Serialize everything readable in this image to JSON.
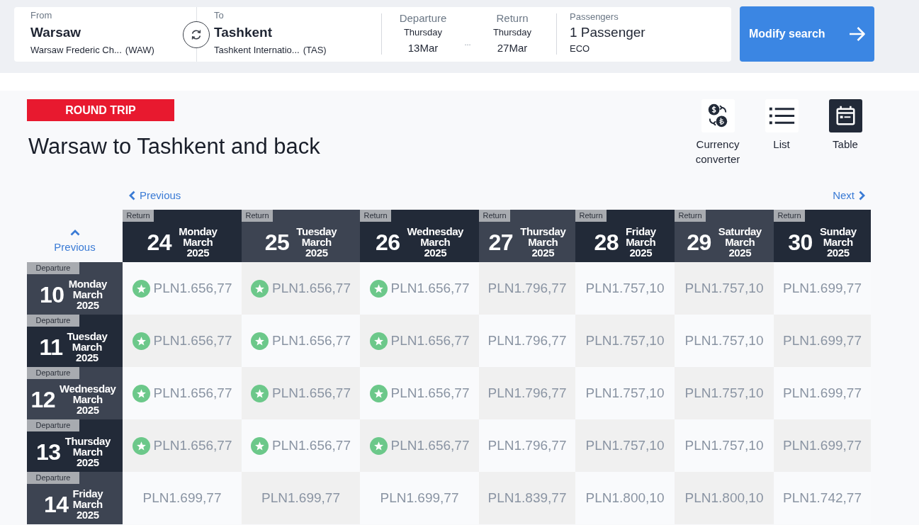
{
  "search_summary": {
    "from": {
      "label": "From",
      "city": "Warsaw",
      "airport": "Warsaw Frederic Ch...",
      "code": "(WAW)"
    },
    "to": {
      "label": "To",
      "city": "Tashkent",
      "airport": "Tashkent Internatio...",
      "code": "(TAS)"
    },
    "departure": {
      "label": "Departure",
      "weekday": "Thursday",
      "date": "13Mar"
    },
    "date_separator": "...",
    "return": {
      "label": "Return",
      "weekday": "Thursday",
      "date": "27Mar"
    },
    "passengers": {
      "label": "Passengers",
      "count": "1 Passenger",
      "cabin": "ECO"
    },
    "modify_button": "Modify search"
  },
  "trip_badge": "ROUND TRIP",
  "title": "Warsaw to Tashkent and back",
  "views": [
    {
      "kind": "currency",
      "label": "Currency converter",
      "selected": false
    },
    {
      "kind": "list",
      "label": "List",
      "selected": false
    },
    {
      "kind": "table",
      "label": "Table",
      "selected": true
    }
  ],
  "fare_table": {
    "previous_return": "Previous",
    "next_return": "Next",
    "previous_departure": "Previous",
    "columns": [
      {
        "tag": "Return",
        "day": "24",
        "weekday": "Monday",
        "month": "March",
        "year": "2025"
      },
      {
        "tag": "Return",
        "day": "25",
        "weekday": "Tuesday",
        "month": "March",
        "year": "2025"
      },
      {
        "tag": "Return",
        "day": "26",
        "weekday": "Wednesday",
        "month": "March",
        "year": "2025"
      },
      {
        "tag": "Return",
        "day": "27",
        "weekday": "Thursday",
        "month": "March",
        "year": "2025"
      },
      {
        "tag": "Return",
        "day": "28",
        "weekday": "Friday",
        "month": "March",
        "year": "2025"
      },
      {
        "tag": "Return",
        "day": "29",
        "weekday": "Saturday",
        "month": "March",
        "year": "2025"
      },
      {
        "tag": "Return",
        "day": "30",
        "weekday": "Sunday",
        "month": "March",
        "year": "2025"
      }
    ],
    "rows": [
      {
        "tag": "Departure",
        "day": "10",
        "weekday": "Monday",
        "month": "March",
        "year": "2025",
        "cells": [
          {
            "price": "PLN1.656,77",
            "starred": true
          },
          {
            "price": "PLN1.656,77",
            "starred": true
          },
          {
            "price": "PLN1.656,77",
            "starred": true
          },
          {
            "price": "PLN1.796,77",
            "starred": false
          },
          {
            "price": "PLN1.757,10",
            "starred": false
          },
          {
            "price": "PLN1.757,10",
            "starred": false
          },
          {
            "price": "PLN1.699,77",
            "starred": false
          }
        ]
      },
      {
        "tag": "Departure",
        "day": "11",
        "weekday": "Tuesday",
        "month": "March",
        "year": "2025",
        "cells": [
          {
            "price": "PLN1.656,77",
            "starred": true
          },
          {
            "price": "PLN1.656,77",
            "starred": true
          },
          {
            "price": "PLN1.656,77",
            "starred": true
          },
          {
            "price": "PLN1.796,77",
            "starred": false
          },
          {
            "price": "PLN1.757,10",
            "starred": false
          },
          {
            "price": "PLN1.757,10",
            "starred": false
          },
          {
            "price": "PLN1.699,77",
            "starred": false
          }
        ]
      },
      {
        "tag": "Departure",
        "day": "12",
        "weekday": "Wednesday",
        "month": "March",
        "year": "2025",
        "cells": [
          {
            "price": "PLN1.656,77",
            "starred": true
          },
          {
            "price": "PLN1.656,77",
            "starred": true
          },
          {
            "price": "PLN1.656,77",
            "starred": true
          },
          {
            "price": "PLN1.796,77",
            "starred": false
          },
          {
            "price": "PLN1.757,10",
            "starred": false
          },
          {
            "price": "PLN1.757,10",
            "starred": false
          },
          {
            "price": "PLN1.699,77",
            "starred": false
          }
        ]
      },
      {
        "tag": "Departure",
        "day": "13",
        "weekday": "Thursday",
        "month": "March",
        "year": "2025",
        "cells": [
          {
            "price": "PLN1.656,77",
            "starred": true
          },
          {
            "price": "PLN1.656,77",
            "starred": true
          },
          {
            "price": "PLN1.656,77",
            "starred": true
          },
          {
            "price": "PLN1.796,77",
            "starred": false
          },
          {
            "price": "PLN1.757,10",
            "starred": false
          },
          {
            "price": "PLN1.757,10",
            "starred": false
          },
          {
            "price": "PLN1.699,77",
            "starred": false
          }
        ]
      },
      {
        "tag": "Departure",
        "day": "14",
        "weekday": "Friday",
        "month": "March",
        "year": "2025",
        "cells": [
          {
            "price": "PLN1.699,77",
            "starred": false
          },
          {
            "price": "PLN1.699,77",
            "starred": false
          },
          {
            "price": "PLN1.699,77",
            "starred": false
          },
          {
            "price": "PLN1.839,77",
            "starred": false
          },
          {
            "price": "PLN1.800,10",
            "starred": false
          },
          {
            "price": "PLN1.800,10",
            "starred": false
          },
          {
            "price": "PLN1.742,77",
            "starred": false
          }
        ]
      }
    ]
  }
}
